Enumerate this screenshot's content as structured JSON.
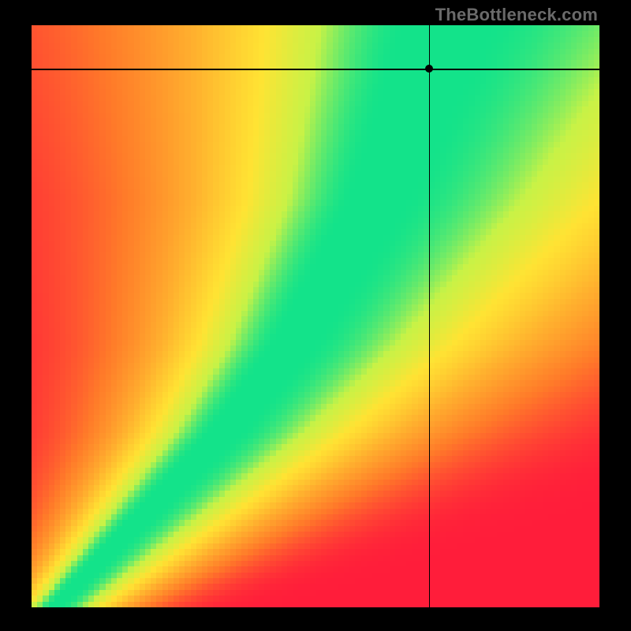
{
  "attribution": "TheBottleneck.com",
  "colors": {
    "red": "#ff1d3a",
    "orange": "#ff7a29",
    "amber": "#ffb02e",
    "yellow": "#ffe333",
    "lime": "#c8f246",
    "green": "#13e38a",
    "teal": "#08d690"
  },
  "chart_data": {
    "type": "heatmap",
    "title": "",
    "xlabel": "",
    "ylabel": "",
    "xlim": [
      0,
      1
    ],
    "ylim": [
      0,
      1
    ],
    "grid_resolution": 100,
    "ridge_center_x_at_y": [
      [
        0.0,
        0.04
      ],
      [
        0.05,
        0.09
      ],
      [
        0.1,
        0.14
      ],
      [
        0.15,
        0.19
      ],
      [
        0.2,
        0.24
      ],
      [
        0.25,
        0.29
      ],
      [
        0.3,
        0.34
      ],
      [
        0.35,
        0.38
      ],
      [
        0.4,
        0.42
      ],
      [
        0.45,
        0.46
      ],
      [
        0.5,
        0.49
      ],
      [
        0.55,
        0.52
      ],
      [
        0.6,
        0.55
      ],
      [
        0.65,
        0.58
      ],
      [
        0.7,
        0.61
      ],
      [
        0.75,
        0.63
      ],
      [
        0.8,
        0.65
      ],
      [
        0.85,
        0.67
      ],
      [
        0.9,
        0.69
      ],
      [
        0.95,
        0.71
      ],
      [
        1.0,
        0.73
      ]
    ],
    "ridge_half_width_at_y": [
      [
        0.0,
        0.01
      ],
      [
        0.1,
        0.015
      ],
      [
        0.2,
        0.02
      ],
      [
        0.3,
        0.025
      ],
      [
        0.4,
        0.03
      ],
      [
        0.5,
        0.035
      ],
      [
        0.6,
        0.04
      ],
      [
        0.7,
        0.045
      ],
      [
        0.8,
        0.052
      ],
      [
        0.9,
        0.06
      ],
      [
        1.0,
        0.07
      ]
    ],
    "crosshair": {
      "x": 0.7,
      "y": 0.925
    },
    "marker_point": {
      "x": 0.7,
      "y": 0.925
    },
    "color_stops": [
      {
        "t": 0.0,
        "hex": "#ff1d3a"
      },
      {
        "t": 0.35,
        "hex": "#ff7a29"
      },
      {
        "t": 0.6,
        "hex": "#ffb02e"
      },
      {
        "t": 0.8,
        "hex": "#ffe333"
      },
      {
        "t": 0.92,
        "hex": "#c8f246"
      },
      {
        "t": 1.0,
        "hex": "#13e38a"
      }
    ]
  }
}
